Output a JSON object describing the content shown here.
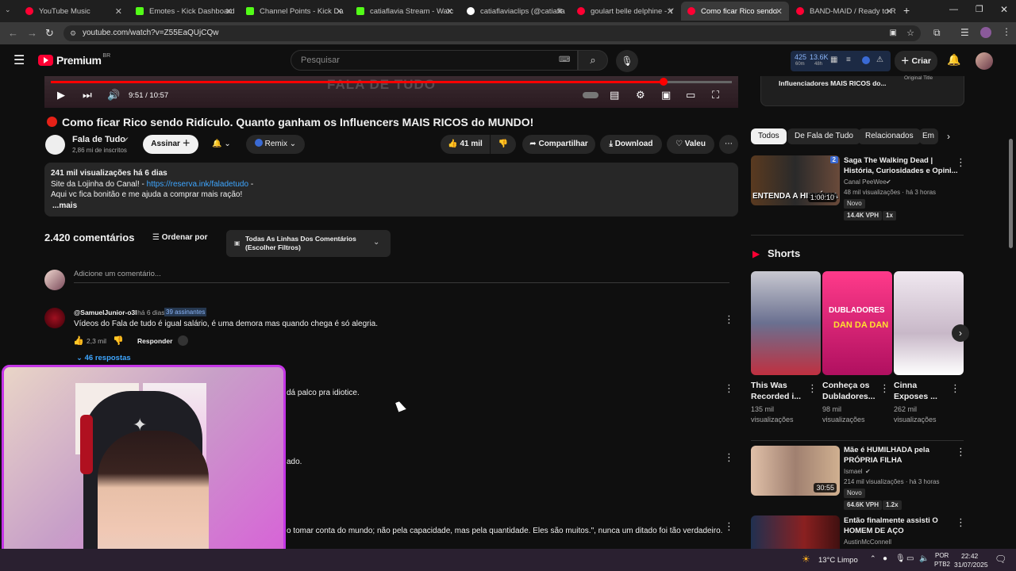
{
  "browser": {
    "tabs": [
      {
        "label": "YouTube Music",
        "color": "#ff0033"
      },
      {
        "label": "Emotes - Kick Dashboard",
        "color": "#53fc18"
      },
      {
        "label": "Channel Points - Kick Da",
        "color": "#53fc18"
      },
      {
        "label": "catiaflavia Stream - Watc",
        "color": "#53fc18"
      },
      {
        "label": "catiaflaviaclips (@catiafla",
        "color": "#ffffff"
      },
      {
        "label": "goulart belle delphine - Y",
        "color": "#ff0033"
      },
      {
        "label": "Como ficar Rico sendo",
        "color": "#ff0033"
      },
      {
        "label": "BAND-MAID / Ready to R",
        "color": "#ff0033"
      }
    ],
    "url": "youtube.com/watch?v=Z55EaQUjCQw"
  },
  "masthead": {
    "logo": "Premium",
    "region": "BR",
    "search_placeholder": "Pesquisar",
    "stats": {
      "a": "425",
      "a_sub": "60m",
      "b": "13.6K",
      "b_sub": "48h"
    },
    "create_label": "Criar"
  },
  "player": {
    "time": "9:51 / 10:57",
    "progress": 0.9,
    "watermark": "FALA DE TUDO"
  },
  "video": {
    "title": "Como ficar Rico sendo Ridículo. Quanto ganham os Influencers MAIS RICOS do MUNDO!",
    "channel": "Fala de Tudo",
    "subscribers": "2,86 mi de inscritos",
    "subscribe_label": "Assinar",
    "remix_label": "Remix",
    "likes": "41 mil",
    "share_label": "Compartilhar",
    "download_label": "Download",
    "thanks_label": "Valeu"
  },
  "description": {
    "meta": "241 mil visualizações  há 6 dias",
    "line1_prefix": "Site da Lojinha do Canal! - ",
    "line1_link": "https://reserva.ink/faladetudo",
    "line1_suffix": " -",
    "line2": "Aqui vc fica bonitão e me ajuda a comprar mais ração!",
    "more": "...mais"
  },
  "comments": {
    "count": "2.420 comentários",
    "sort_label": "Ordenar por",
    "filter_line1": "Todas As Linhas Dos Comentários",
    "filter_line2": "(Escolher Filtros)",
    "add_placeholder": "Adicione um comentário...",
    "first": {
      "author": "@SamuelJunior-o3l",
      "time": "há 6 dias",
      "badge": "39 assinantes",
      "text": "Vídeos do Fala de tudo é igual salário, é uma demora mas quando chega é só alegria.",
      "likes": "2,3 mil",
      "reply_label": "Responder",
      "replies": "46 respostas"
    },
    "partial": [
      "dá palco pra idiotice.",
      "ado.",
      "o tomar conta do mundo; não pela capacidade, mas pela quantidade. Eles são muitos.\", nunca um ditado foi tão verdadeiro."
    ]
  },
  "sidebar": {
    "top_card": {
      "line1": "Influenciadores MAIS RICOS do...",
      "tag": "Original Title"
    },
    "chips": [
      "Todos",
      "De Fala de Tudo",
      "Relacionados",
      "Em"
    ],
    "videos": [
      {
        "title1": "Saga The Walking Dead |",
        "title2": "História, Curiosidades e Opini...",
        "channel": "Canal PeeWee",
        "meta": "48 mil visualizações · há 3 horas",
        "badge": "Novo",
        "duration": "1:00:10",
        "thumb_text": "ENTENDA A HISTÓRIA",
        "stat1": "14.4K VPH",
        "stat2": "1x"
      },
      {
        "title1": "Mãe é HUMILHADA pela",
        "title2": "PRÓPRIA FILHA",
        "channel": "Ismael",
        "meta": "214 mil visualizações · há 3 horas",
        "badge": "Novo",
        "duration": "30:55",
        "stat1": "64.6K VPH",
        "stat2": "1.2x"
      },
      {
        "title1": "Então finalmente assisti O",
        "title2": "HOMEM DE AÇO",
        "channel": "AustinMcConnell"
      }
    ],
    "shorts_title": "Shorts",
    "shorts": [
      {
        "title": "This Was Recorded i...",
        "views1": "135 mil",
        "views2": "visualizações"
      },
      {
        "title": "Conheça os Dubladores...",
        "views1": "98 mil",
        "views2": "visualizações",
        "thumb_text1": "DUBLADORES",
        "thumb_text2": "DAN DA DAN"
      },
      {
        "title": "Cinna Exposes ...",
        "views1": "262 mil",
        "views2": "visualizações"
      }
    ]
  },
  "taskbar": {
    "weather": "13°C  Limpo",
    "lang1": "POR",
    "lang2": "PTB2",
    "time": "22:42",
    "date": "31/07/2025"
  }
}
